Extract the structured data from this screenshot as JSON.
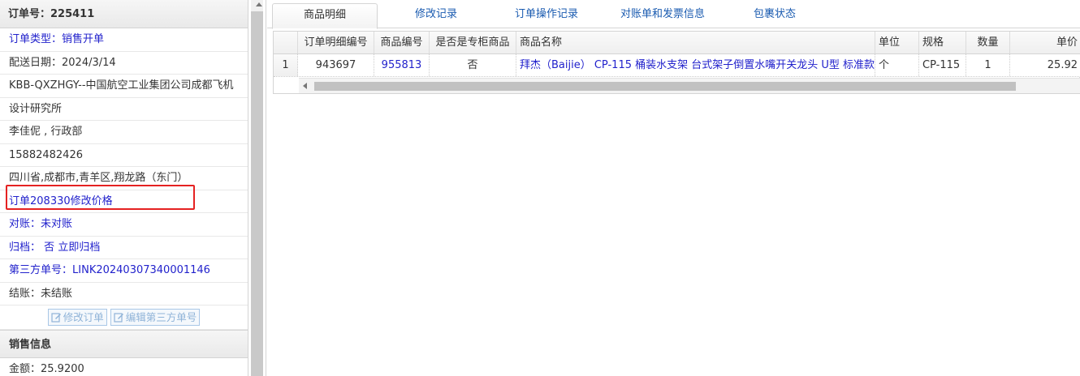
{
  "order": {
    "title": "订单号：225411",
    "type": "订单类型：销售开单",
    "delivery_date": "配送日期：2024/3/14",
    "customer_line1": "KBB-QXZHGY--中国航空工业集团公司成都飞机",
    "customer_line2": "设计研究所",
    "contact": "李佳伲 , 行政部",
    "phone": "15882482426",
    "address": "四川省,成都市,青羊区,翔龙路（东门）",
    "modify_link": "订单208330修改价格",
    "reconcile_label": "对账：",
    "reconcile_value": "未对账",
    "archive_label": "归档：",
    "archive_value": "否",
    "archive_action": "立即归档",
    "third_party_label": "第三方单号：",
    "third_party_value": "LINK20240307340001146",
    "settlement": "结账：未结账",
    "btn_edit_order": "修改订单",
    "btn_edit_third": "编辑第三方单号"
  },
  "sales": {
    "header": "销售信息",
    "amount": "金额：25.9200"
  },
  "tabs": [
    "商品明细",
    "修改记录",
    "订单操作记录",
    "对账单和发票信息",
    "包裹状态"
  ],
  "grid": {
    "columns": [
      "订单明细编号",
      "商品编号",
      "是否是专柜商品",
      "商品名称",
      "单位",
      "规格",
      "数量",
      "单价"
    ],
    "rows": [
      {
        "index": "1",
        "detail_no": "943697",
        "product_no": "955813",
        "is_counter": "否",
        "name": "拜杰（Baijie） CP-115 桶装水支架 台式架子倒置水嘴开关龙头 U型 标准款",
        "unit": "个",
        "spec": "CP-115",
        "qty": "1",
        "price": "25.92"
      }
    ]
  },
  "colors": {
    "link": "#2222cc",
    "highlight_box": "#e52222",
    "button_text": "#8fb3d8"
  }
}
